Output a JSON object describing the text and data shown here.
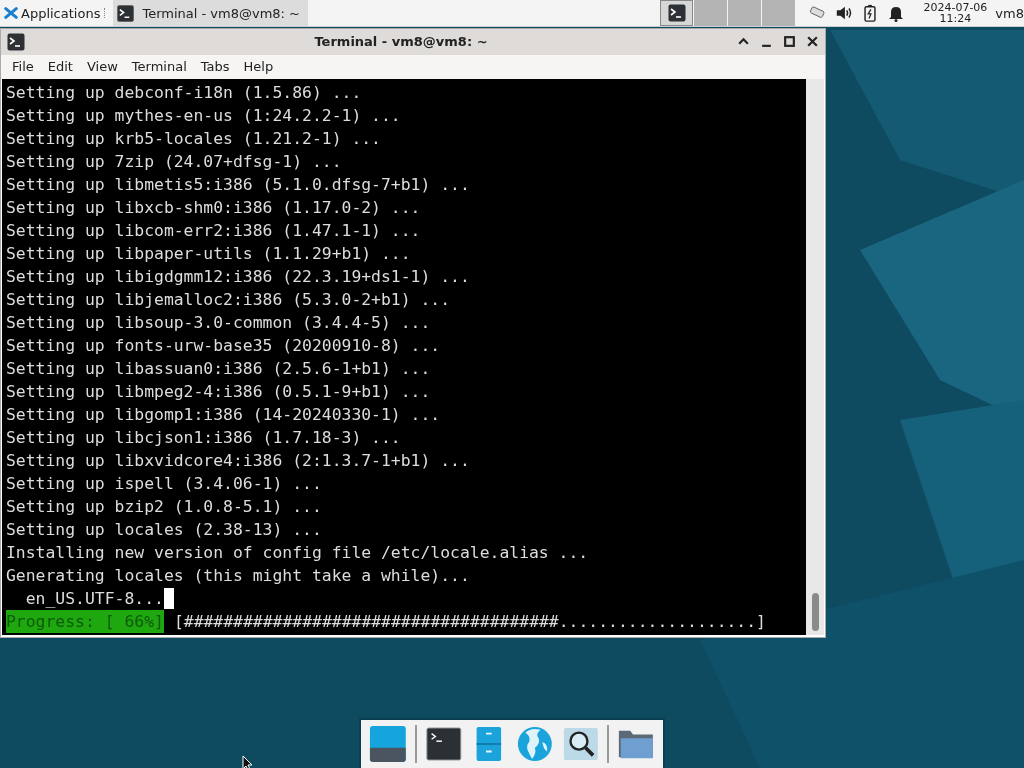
{
  "panel": {
    "applications_label": "Applications",
    "taskbar_items": [
      {
        "title": "Terminal - vm8@vm8: ~",
        "selected": true
      }
    ],
    "workspaces": [
      {
        "selected": true,
        "has_window": true
      },
      {
        "selected": false,
        "has_window": false
      },
      {
        "selected": false,
        "has_window": false
      },
      {
        "selected": false,
        "has_window": false
      }
    ],
    "clock": {
      "date": "2024-07-06",
      "time": "11:24"
    },
    "user": "vm8"
  },
  "window": {
    "title": "Terminal - vm8@vm8: ~",
    "menu": [
      "File",
      "Edit",
      "View",
      "Terminal",
      "Tabs",
      "Help"
    ],
    "lines": [
      "Setting up debconf-i18n (1.5.86) ...",
      "Setting up mythes-en-us (1:24.2.2-1) ...",
      "Setting up krb5-locales (1.21.2-1) ...",
      "Setting up 7zip (24.07+dfsg-1) ...",
      "Setting up libmetis5:i386 (5.1.0.dfsg-7+b1) ...",
      "Setting up libxcb-shm0:i386 (1.17.0-2) ...",
      "Setting up libcom-err2:i386 (1.47.1-1) ...",
      "Setting up libpaper-utils (1.1.29+b1) ...",
      "Setting up libigdgmm12:i386 (22.3.19+ds1-1) ...",
      "Setting up libjemalloc2:i386 (5.3.0-2+b1) ...",
      "Setting up libsoup-3.0-common (3.4.4-5) ...",
      "Setting up fonts-urw-base35 (20200910-8) ...",
      "Setting up libassuan0:i386 (2.5.6-1+b1) ...",
      "Setting up libmpeg2-4:i386 (0.5.1-9+b1) ...",
      "Setting up libgomp1:i386 (14-20240330-1) ...",
      "Setting up libcjson1:i386 (1.7.18-3) ...",
      "Setting up libxvidcore4:i386 (2:1.3.7-1+b1) ...",
      "Setting up ispell (3.4.06-1) ...",
      "Setting up bzip2 (1.0.8-5.1) ...",
      "Setting up locales (2.38-13) ...",
      "Installing new version of config file /etc/locale.alias ...",
      "Generating locales (this might take a while)..."
    ],
    "prompt_line": "  en_US.UTF-8...",
    "progress": {
      "label": "Progress: [ 66%]",
      "bar": "[######################################....................]"
    }
  }
}
